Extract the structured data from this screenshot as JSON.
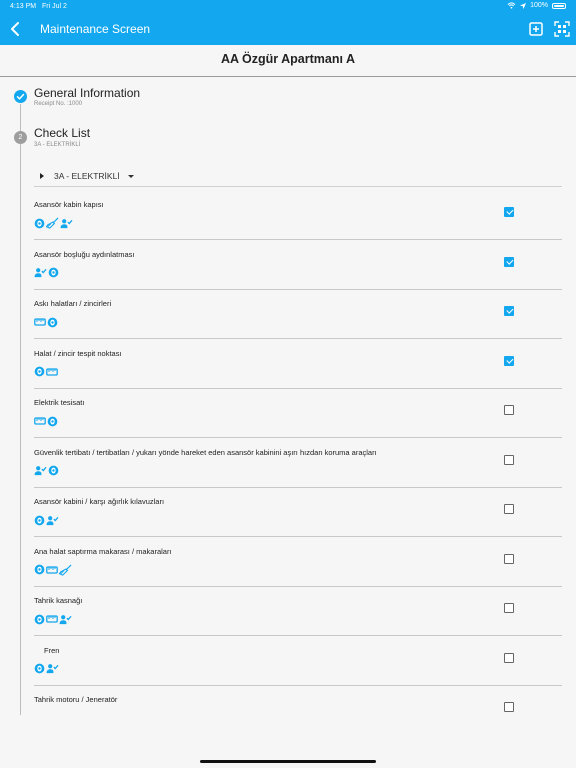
{
  "status_bar": {
    "time": "4:13 PM",
    "date": "Fri Jul 2",
    "battery": "100%"
  },
  "app_bar": {
    "title": "Maintenance Screen"
  },
  "header": {
    "title": "AA Özgür Apartmanı A"
  },
  "steps": [
    {
      "title": "General Information",
      "subtitle": "Receipt No. :1000",
      "state": "done"
    },
    {
      "number": "2",
      "title": "Check List",
      "subtitle": "3A - ELEKTRİKLİ",
      "state": "active"
    }
  ],
  "section": {
    "label": "3A - ELEKTRİKLİ"
  },
  "colors": {
    "accent": "#12a7ee",
    "gray_step": "#9e9e9e"
  },
  "items": [
    {
      "name": "Asansör kabin kapısı",
      "icons": [
        "eye-icon",
        "broom-icon",
        "person-check-icon"
      ],
      "checked": true
    },
    {
      "name": "Asansör boşluğu aydınlatması",
      "icons": [
        "person-check-icon",
        "eye-icon"
      ],
      "checked": true
    },
    {
      "name": "Askı halatları / zincirleri",
      "icons": [
        "ruler-icon",
        "eye-icon"
      ],
      "checked": true
    },
    {
      "name": "Halat / zincir tespit noktası",
      "icons": [
        "eye-icon",
        "ruler-icon"
      ],
      "checked": true
    },
    {
      "name": "Elektrik tesisatı",
      "icons": [
        "ruler-icon",
        "eye-icon"
      ],
      "checked": false
    },
    {
      "name": "Güvenlik tertibatı / tertibatları / yukarı yönde hareket eden asansör kabinini aşırı hızdan koruma araçları",
      "icons": [
        "person-check-icon",
        "eye-icon"
      ],
      "checked": false
    },
    {
      "name": "Asansör kabini / karşı ağırlık kılavuzları",
      "icons": [
        "eye-icon",
        "person-check-icon"
      ],
      "checked": false
    },
    {
      "name": "Ana halat saptırma makarası / makaraları",
      "icons": [
        "eye-icon",
        "ruler-icon",
        "broom-icon"
      ],
      "checked": false
    },
    {
      "name": "Tahrik kasnağı",
      "icons": [
        "eye-icon",
        "ruler-icon",
        "person-check-icon"
      ],
      "checked": false
    },
    {
      "name": "Fren",
      "icons": [
        "eye-icon",
        "person-check-icon"
      ],
      "checked": false
    },
    {
      "name": "Tahrik motoru / Jeneratör",
      "icons": [],
      "checked": false
    }
  ]
}
